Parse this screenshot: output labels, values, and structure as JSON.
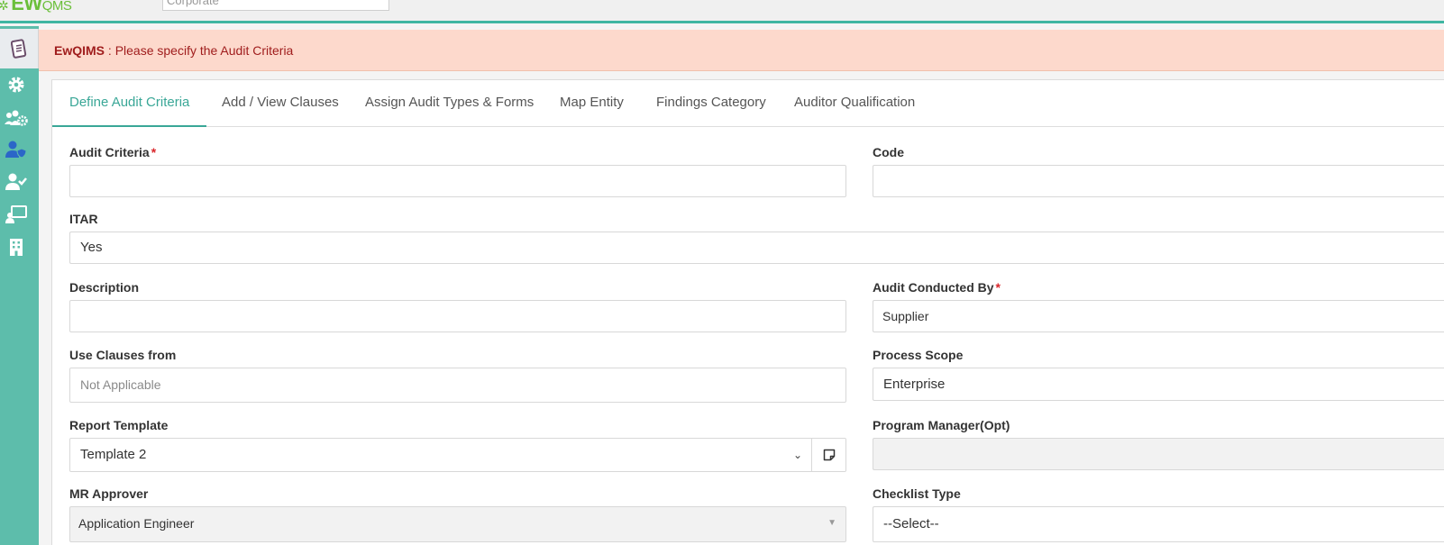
{
  "topbar": {
    "logo_main": "EW",
    "logo_small": "QMS",
    "org_value": "Corporate"
  },
  "alert": {
    "app": "EwQIMS",
    "separator": " : ",
    "message": "Please specify the Audit Criteria"
  },
  "tabs": [
    {
      "label": "Define Audit Criteria",
      "active": true
    },
    {
      "label": "Add / View Clauses"
    },
    {
      "label": "Assign Audit Types & Forms"
    },
    {
      "label": "Map Entity"
    },
    {
      "label": "Findings Category"
    },
    {
      "label": "Auditor Qualification"
    }
  ],
  "form": {
    "audit_criteria": {
      "label": "Audit Criteria",
      "value": "",
      "required": "*"
    },
    "code": {
      "label": "Code",
      "value": ""
    },
    "itar": {
      "label": "ITAR",
      "value": "Yes"
    },
    "description": {
      "label": "Description",
      "value": ""
    },
    "audit_conducted_by": {
      "label": "Audit Conducted By",
      "value": "Supplier",
      "required": "*"
    },
    "use_clauses_from": {
      "label": "Use Clauses from",
      "value": "Not Applicable"
    },
    "process_scope": {
      "label": "Process Scope",
      "value": "Enterprise"
    },
    "report_template": {
      "label": "Report Template",
      "value": "Template 2"
    },
    "program_manager": {
      "label": "Program Manager(Opt)",
      "value": ""
    },
    "mr_approver": {
      "label": "MR Approver",
      "value": "Application Engineer"
    },
    "checklist_type": {
      "label": "Checklist Type",
      "value": "--Select--"
    }
  },
  "icons": {
    "sidebar": [
      "clipboard-icon",
      "gear-icon",
      "users-gear-icon",
      "user-shield-icon",
      "user-check-icon",
      "chalkboard-user-icon",
      "building-icon"
    ],
    "report_addon": "sticky-note-icon"
  },
  "colors": {
    "brand_green": "#6bbf3a",
    "sidebar_teal": "#5dbdab",
    "active_tab": "#3aa797",
    "alert_bg": "#fdd9cc",
    "alert_text": "#a01d1d",
    "required": "#d9262b"
  }
}
